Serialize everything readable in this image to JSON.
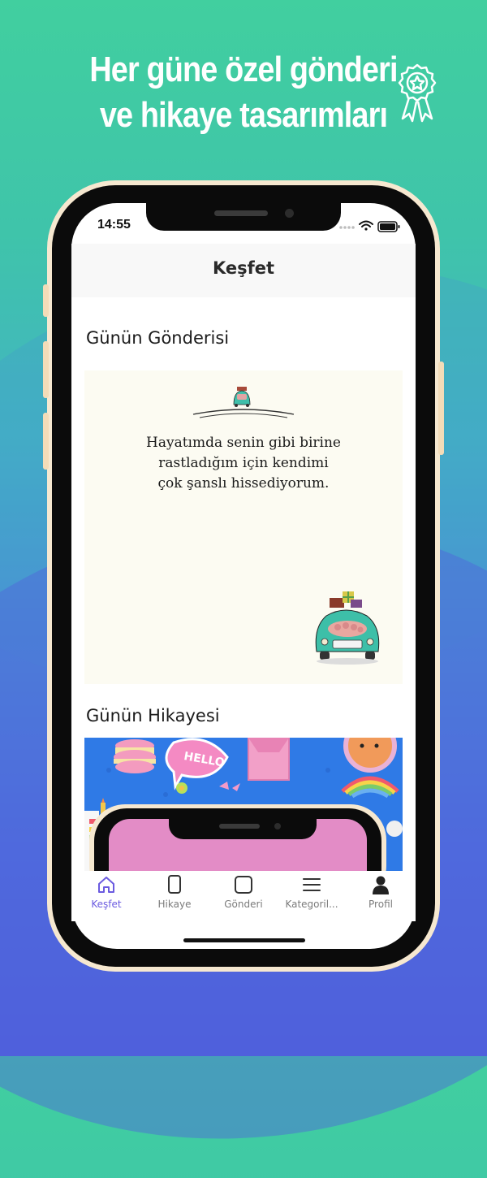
{
  "headline": {
    "line1": "Her güne özel gönderi",
    "line2": "ve hikaye tasarımları"
  },
  "colors": {
    "accent": "#6b5be0",
    "tab_inactive": "#7b7b7b",
    "post_bg": "#fcfbf2",
    "story_bg": "#2f7ae6"
  },
  "status_bar": {
    "time": "14:55"
  },
  "header": {
    "title": "Keşfet"
  },
  "post_section": {
    "title": "Günün Gönderisi",
    "quote_line1": "Hayatımda senin gibi birine",
    "quote_line2": "rastladığım için kendimi",
    "quote_line3": "çok şanslı hissediyorum."
  },
  "story_section": {
    "title": "Günün Hikayesi",
    "sticker_text": "HELLO"
  },
  "tabbar": {
    "items": [
      {
        "label": "Keşfet",
        "icon": "home-icon",
        "active": true
      },
      {
        "label": "Hikaye",
        "icon": "story-icon",
        "active": false
      },
      {
        "label": "Gönderi",
        "icon": "post-icon",
        "active": false
      },
      {
        "label": "Kategoril...",
        "icon": "menu-icon",
        "active": false
      },
      {
        "label": "Profil",
        "icon": "profile-icon",
        "active": false
      }
    ]
  }
}
